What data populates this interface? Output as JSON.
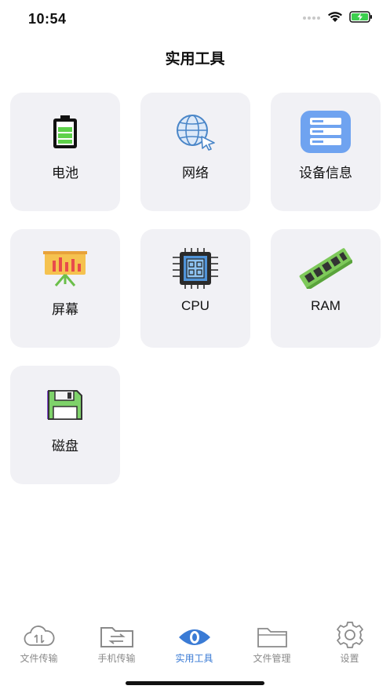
{
  "status": {
    "time": "10:54"
  },
  "header": {
    "title": "实用工具"
  },
  "tools": [
    {
      "label": "电池",
      "icon": "battery-icon"
    },
    {
      "label": "网络",
      "icon": "network-globe-icon"
    },
    {
      "label": "设备信息",
      "icon": "server-info-icon"
    },
    {
      "label": "屏幕",
      "icon": "screen-board-icon"
    },
    {
      "label": "CPU",
      "icon": "cpu-chip-icon"
    },
    {
      "label": "RAM",
      "icon": "ram-stick-icon"
    },
    {
      "label": "磁盘",
      "icon": "floppy-disk-icon"
    }
  ],
  "tabbar": {
    "items": [
      {
        "label": "文件传输",
        "icon": "cloud-transfer-icon",
        "active": false
      },
      {
        "label": "手机传输",
        "icon": "folder-swap-icon",
        "active": false
      },
      {
        "label": "实用工具",
        "icon": "eye-icon",
        "active": true
      },
      {
        "label": "文件管理",
        "icon": "folder-icon",
        "active": false
      },
      {
        "label": "设置",
        "icon": "gear-icon",
        "active": false
      }
    ]
  },
  "colors": {
    "accent": "#3a7bd5",
    "card_bg": "#f1f1f5",
    "tab_inactive": "#8a8a8a"
  }
}
